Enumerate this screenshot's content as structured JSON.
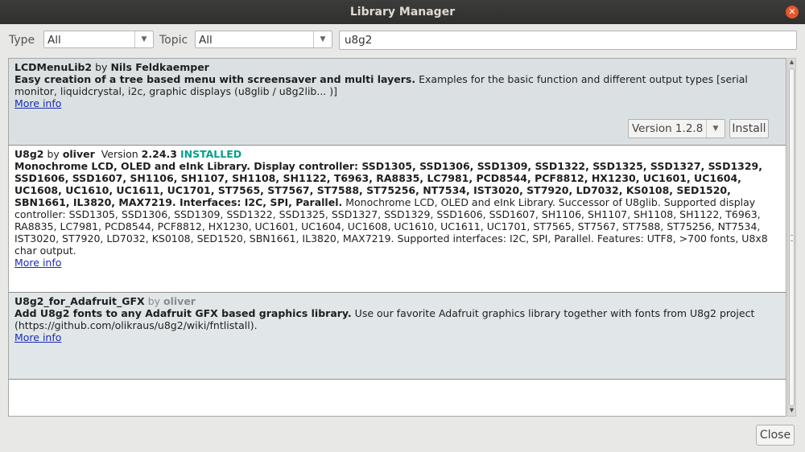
{
  "window": {
    "title": "Library Manager"
  },
  "filters": {
    "type_label": "Type",
    "type_value": "All",
    "topic_label": "Topic",
    "topic_value": "All",
    "search_value": "u8g2"
  },
  "libraries": [
    {
      "name": "LCDMenuLib2",
      "by": "by",
      "author": "Nils Feldkaemper",
      "summary": "Easy creation of a tree based menu with screensaver and multi layers.",
      "description": "Examples for the basic function and different output types [serial monitor, liquidcrystal, i2c, graphic displays (u8glib / u8g2lib... )]",
      "more_info": "More info",
      "version_select": "Version 1.2.8",
      "install_label": "Install"
    },
    {
      "name": "U8g2",
      "by": "by",
      "author": "oliver",
      "version_label": "Version",
      "version": "2.24.3",
      "installed": "INSTALLED",
      "summary": "Monochrome LCD, OLED and eInk Library. Display controller: SSD1305, SSD1306, SSD1309, SSD1322, SSD1325, SSD1327, SSD1329, SSD1606, SSD1607, SH1106, SH1107, SH1108, SH1122, T6963, RA8835, LC7981, PCD8544, PCF8812, HX1230, UC1601, UC1604, UC1608, UC1610, UC1611, UC1701, ST7565, ST7567, ST7588, ST75256, NT7534, IST3020, ST7920, LD7032, KS0108, SED1520, SBN1661, IL3820, MAX7219. Interfaces: I2C, SPI, Parallel.",
      "description": "Monochrome LCD, OLED and eInk Library. Successor of U8glib. Supported display controller: SSD1305, SSD1306, SSD1309, SSD1322, SSD1325, SSD1327, SSD1329, SSD1606, SSD1607, SH1106, SH1107, SH1108, SH1122, T6963, RA8835, LC7981, PCD8544, PCF8812, HX1230, UC1601, UC1604, UC1608, UC1610, UC1611, UC1701, ST7565, ST7567, ST7588, ST75256, NT7534, IST3020, ST7920, LD7032, KS0108, SED1520, SBN1661, IL3820, MAX7219. Supported interfaces: I2C, SPI, Parallel. Features: UTF8, >700 fonts, U8x8 char output.",
      "more_info": "More info"
    },
    {
      "name": "U8g2_for_Adafruit_GFX",
      "by": "by",
      "author": "oliver",
      "summary": "Add U8g2 fonts to any Adafruit GFX based graphics library.",
      "description": "Use our favorite Adafruit graphics library together with fonts from U8g2 project (https://github.com/olikraus/u8g2/wiki/fntlistall).",
      "more_info": "More info"
    }
  ],
  "footer": {
    "close_label": "Close"
  },
  "colors": {
    "titlebar": "#2f2f2d",
    "installed": "#07a08a",
    "link": "#1a2cb4",
    "selected_row": "#dbe1e3"
  }
}
